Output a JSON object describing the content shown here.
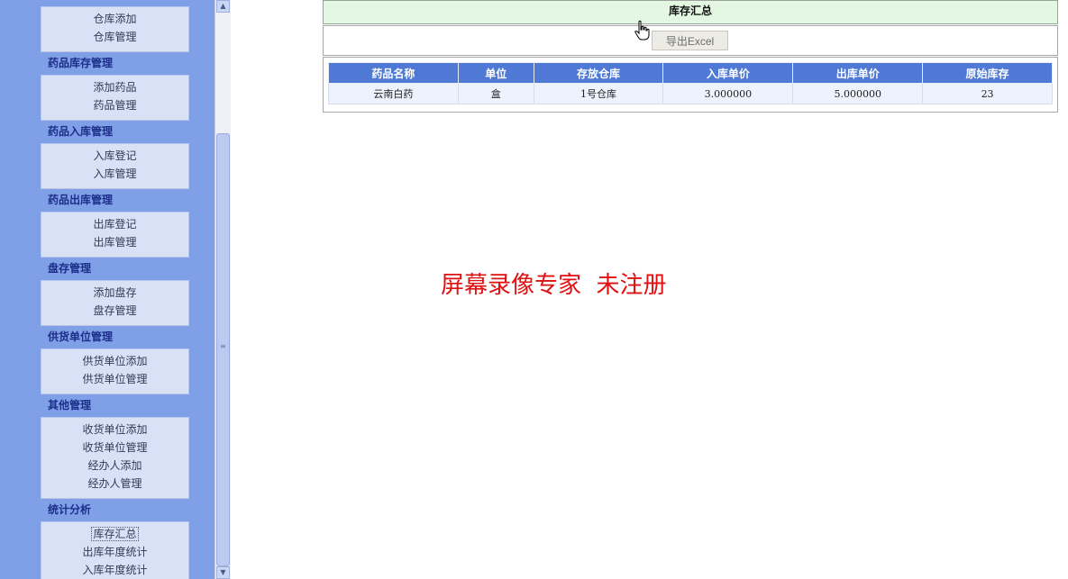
{
  "sidebar": {
    "groups": [
      {
        "title": "",
        "items": [
          "仓库添加",
          "仓库管理"
        ]
      },
      {
        "title": "药品库存管理",
        "items": [
          "添加药品",
          "药品管理"
        ]
      },
      {
        "title": "药品入库管理",
        "items": [
          "入库登记",
          "入库管理"
        ]
      },
      {
        "title": "药品出库管理",
        "items": [
          "出库登记",
          "出库管理"
        ]
      },
      {
        "title": "盘存管理",
        "items": [
          "添加盘存",
          "盘存管理"
        ]
      },
      {
        "title": "供货单位管理",
        "items": [
          "供货单位添加",
          "供货单位管理"
        ]
      },
      {
        "title": "其他管理",
        "items": [
          "收货单位添加",
          "收货单位管理",
          "经办人添加",
          "经办人管理"
        ]
      },
      {
        "title": "统计分析",
        "items": [
          "库存汇总",
          "出库年度统计",
          "入库年度统计"
        ]
      }
    ],
    "active_item": "库存汇总"
  },
  "scrollbar": {
    "up_icon": "arrow-up-icon",
    "down_icon": "arrow-down-icon"
  },
  "main": {
    "header_title": "库存汇总",
    "export_button": "导出Excel",
    "table": {
      "columns": [
        "药品名称",
        "单位",
        "存放仓库",
        "入库单价",
        "出库单价",
        "原始库存"
      ],
      "rows": [
        [
          "云南白药",
          "盒",
          "1号仓库",
          "3.000000",
          "5.000000",
          "23"
        ]
      ]
    }
  },
  "watermark": "屏幕录像专家  未注册",
  "colors": {
    "sidebar_bg": "#7f9fe6",
    "group_title": "#1b2f8a",
    "table_header": "#4f79d4",
    "summary_header_bg": "#e3f7e3",
    "watermark": "#e01010"
  }
}
